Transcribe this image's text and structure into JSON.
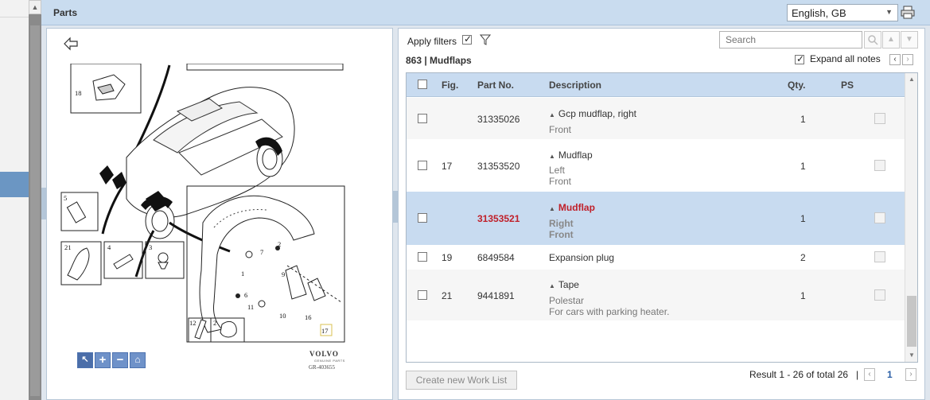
{
  "header": {
    "title": "Parts",
    "language": "English, GB"
  },
  "drawing": {
    "manufacturer": "VOLVO",
    "manufacturer_sub": "GENUINE PARTS",
    "code": "GR-403655",
    "callouts": [
      "18",
      "5",
      "21",
      "4",
      "3",
      "2",
      "7",
      "1",
      "9",
      "6",
      "11",
      "10",
      "16",
      "12",
      "2",
      "17"
    ]
  },
  "filters": {
    "apply_label": "Apply filters",
    "apply_checked": true
  },
  "section": {
    "title": "863  |  Mudflaps"
  },
  "search": {
    "placeholder": "Search"
  },
  "expand": {
    "label": "Expand all notes",
    "checked": true
  },
  "table": {
    "headers": {
      "fig": "Fig.",
      "part_no": "Part No.",
      "description": "Description",
      "qty": "Qty.",
      "ps": "PS"
    },
    "rows": [
      {
        "fig": "",
        "part_no": "31335026",
        "description": "Gcp mudflap, right",
        "details": [
          "Front"
        ],
        "qty": "1",
        "selected": false
      },
      {
        "fig": "17",
        "part_no": "31353520",
        "description": "Mudflap",
        "details": [
          "Left",
          "Front"
        ],
        "qty": "1",
        "selected": false
      },
      {
        "fig": "",
        "part_no": "31353521",
        "description": "Mudflap",
        "details": [
          "Right",
          "Front"
        ],
        "qty": "1",
        "selected": true
      },
      {
        "fig": "19",
        "part_no": "6849584",
        "description": "Expansion plug",
        "details": [],
        "qty": "2",
        "selected": false
      },
      {
        "fig": "21",
        "part_no": "9441891",
        "description": "Tape",
        "details": [
          "Polestar",
          "For cars with parking heater."
        ],
        "qty": "1",
        "selected": false
      }
    ]
  },
  "footer": {
    "worklist_label": "Create new Work List",
    "result_text": "Result 1 - 26 of total 26",
    "separator": "|",
    "page": "1"
  },
  "colors": {
    "header_bg": "#c9dcef",
    "selected_row": "#c8dbf0",
    "selected_text": "#c0202a",
    "tool_blue": "#6f92c9"
  },
  "icons": [
    "print-icon",
    "back-arrow-icon",
    "filter-icon",
    "search-icon",
    "chevron-up-icon",
    "chevron-down-icon",
    "note-icon",
    "pointer-icon",
    "zoom-in-icon",
    "zoom-out-icon",
    "home-icon"
  ]
}
